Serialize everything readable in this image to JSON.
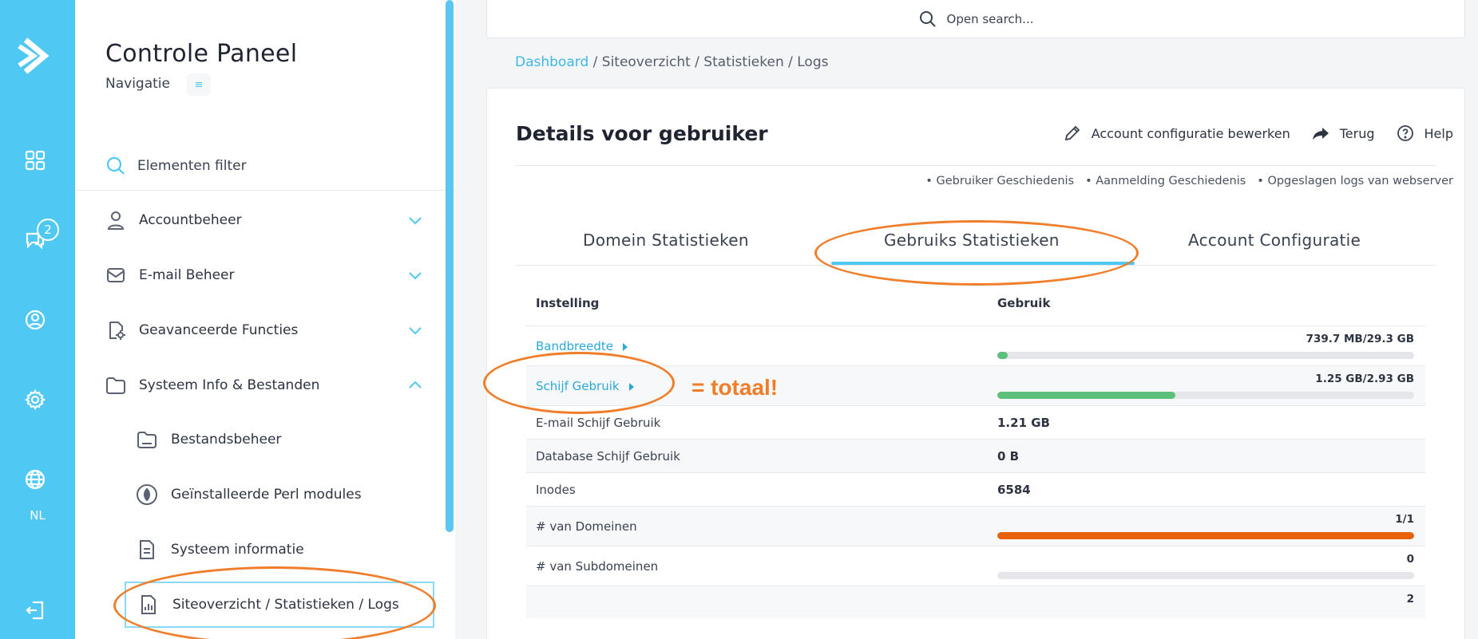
{
  "rail": {
    "lang": "NL",
    "chat_badge": "2",
    "accent": "#4fc8f3"
  },
  "sidebar": {
    "title": "Controle Paneel",
    "subtitle": "Navigatie",
    "filter_placeholder": "Elementen filter",
    "items": [
      {
        "label": "Accountbeheer",
        "icon": "user-icon"
      },
      {
        "label": "E-mail Beheer",
        "icon": "mail-icon"
      },
      {
        "label": "Geavanceerde Functies",
        "icon": "advanced-icon"
      },
      {
        "label": "Systeem Info & Bestanden",
        "icon": "folder-icon"
      }
    ],
    "subitems": [
      {
        "label": "Bestandsbeheer",
        "icon": "folder-icon"
      },
      {
        "label": "Geïnstalleerde Perl modules",
        "icon": "perl-icon"
      },
      {
        "label": "Systeem informatie",
        "icon": "document-icon"
      },
      {
        "label": "Siteoverzicht / Statistieken / Logs",
        "icon": "stats-icon"
      }
    ]
  },
  "search": {
    "label": "Open search..."
  },
  "breadcrumb": {
    "root": "Dashboard",
    "rest": "/ Siteoverzicht / Statistieken / Logs"
  },
  "card": {
    "heading": "Details voor gebruiker",
    "actions": {
      "edit": "Account configuratie bewerken",
      "back": "Terug",
      "help": "Help"
    },
    "links": [
      "• Gebruiker Geschiedenis",
      "• Aanmelding Geschiedenis",
      "• Opgeslagen logs van webserver"
    ],
    "tabs": [
      "Domein Statistieken",
      "Gebruiks Statistieken",
      "Account Configuratie"
    ],
    "table": {
      "col_setting": "Instelling",
      "col_usage": "Gebruik",
      "rows": [
        {
          "name": "Bandbreedte",
          "bar_label": "739.7 MB/29.3 GB",
          "fill": 0.025,
          "color": "#5cc07a"
        },
        {
          "name": "Schijf Gebruik",
          "bar_label": "1.25 GB/2.93 GB",
          "fill": 0.427,
          "color": "#5cc07a"
        },
        {
          "name": "E-mail Schijf Gebruik",
          "value": "1.21 GB"
        },
        {
          "name": "Database Schijf Gebruik",
          "value": "0 B"
        },
        {
          "name": "Inodes",
          "value": "6584"
        },
        {
          "name": "# van Domeinen",
          "bar_label": "1/1",
          "fill": 1.0,
          "color": "#e8620e"
        },
        {
          "name": "# van Subdomeinen",
          "bar_label": "0",
          "fill": 0.0,
          "color": "#5cc07a"
        }
      ],
      "partial_last": "2"
    }
  },
  "annotation": {
    "note": "= totaal!",
    "color": "#f07d2a"
  }
}
